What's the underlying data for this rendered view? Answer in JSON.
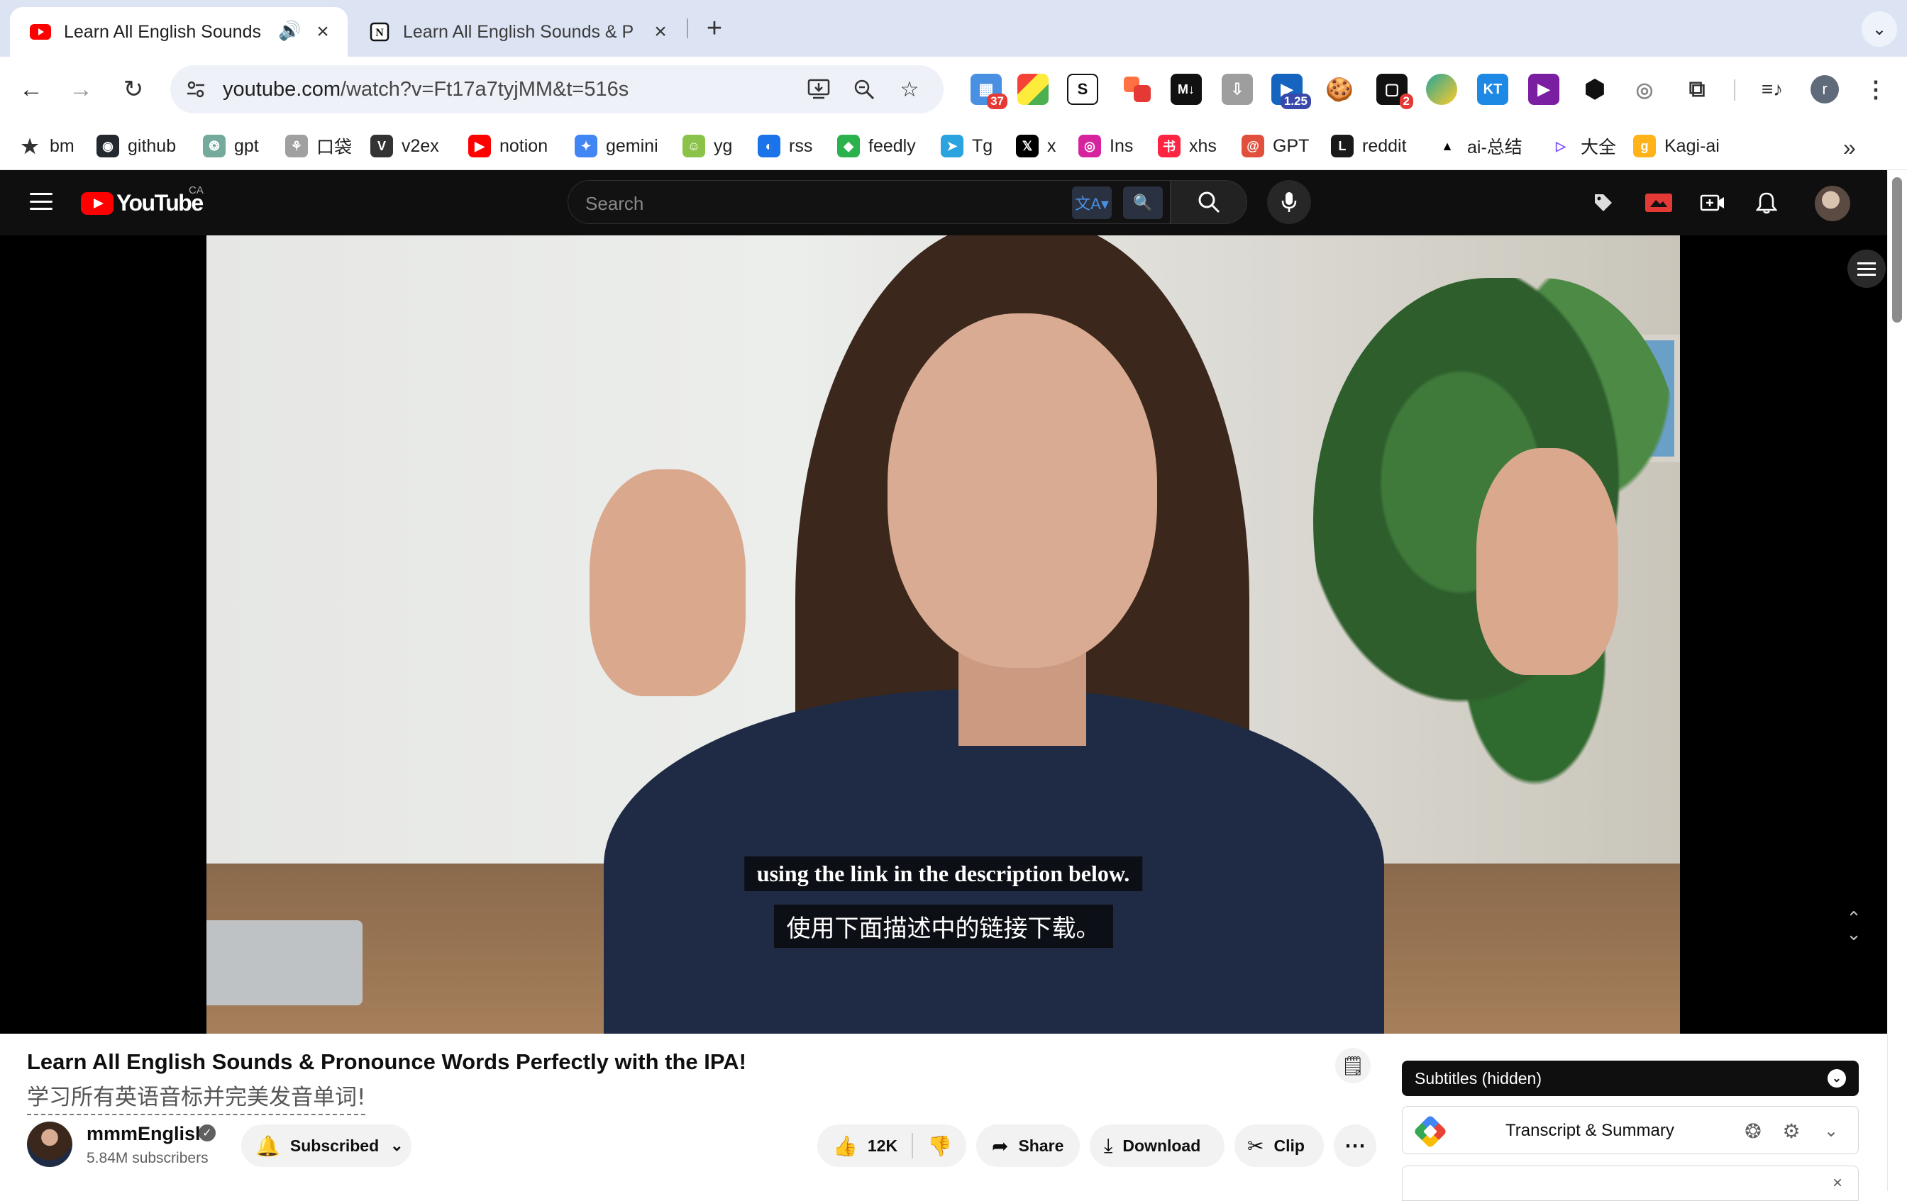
{
  "browser": {
    "tabs": [
      {
        "title": "Learn All English Sounds",
        "favicon": "youtube-icon",
        "audio": "speaker-icon",
        "active": true
      },
      {
        "title": "Learn All English Sounds & P",
        "favicon": "notion-icon",
        "active": false
      }
    ],
    "new_tab": "+",
    "tab_search": "⌄",
    "url_host": "youtube.com",
    "url_path": "/watch?v=Ft17a7tyjMM&t=516s",
    "extensions": [
      {
        "name": "ext-grid",
        "badge": "37"
      },
      {
        "name": "ext-colors"
      },
      {
        "name": "ext-s",
        "label": "S"
      },
      {
        "name": "ext-shapes"
      },
      {
        "name": "ext-markdown",
        "label": "M↓"
      },
      {
        "name": "ext-download"
      },
      {
        "name": "ext-speed",
        "badge": "1.25"
      },
      {
        "name": "ext-cookie"
      },
      {
        "name": "ext-chat",
        "badge": "2"
      },
      {
        "name": "ext-shield"
      },
      {
        "name": "ext-kt",
        "label": "KT"
      },
      {
        "name": "ext-play"
      },
      {
        "name": "ext-cube"
      },
      {
        "name": "ext-eye"
      },
      {
        "name": "ext-puzzle"
      }
    ],
    "profile_initial": "r",
    "bookmarks": [
      {
        "label": "bm",
        "icon": "star-icon",
        "color": "#333333"
      },
      {
        "label": "github",
        "icon": "github-icon",
        "color": "#24292f"
      },
      {
        "label": "gpt",
        "icon": "openai-icon",
        "color": "#74aa9c"
      },
      {
        "label": "口袋",
        "icon": "pocket-icon",
        "color": "#a0a0a0"
      },
      {
        "label": "v2ex",
        "icon": "v2ex-icon",
        "color": "#333333"
      },
      {
        "label": "notion",
        "icon": "youtube-icon",
        "color": "#ff0000"
      },
      {
        "label": "gemini",
        "icon": "gemini-icon",
        "color": "#4285f4"
      },
      {
        "label": "yg",
        "icon": "people-icon",
        "color": "#8bc34a"
      },
      {
        "label": "rss",
        "icon": "rss-icon",
        "color": "#1a73e8"
      },
      {
        "label": "feedly",
        "icon": "feedly-icon",
        "color": "#2bb24c"
      },
      {
        "label": "Tg",
        "icon": "telegram-icon",
        "color": "#2aa3df"
      },
      {
        "label": "x",
        "icon": "x-icon",
        "color": "#000000"
      },
      {
        "label": "Ins",
        "icon": "instagram-icon",
        "color": "#d6249f"
      },
      {
        "label": "xhs",
        "icon": "xiaohongshu-icon",
        "color": "#ff2442"
      },
      {
        "label": "GPT",
        "icon": "spiral-icon",
        "color": "#e0503c"
      },
      {
        "label": "reddit",
        "icon": "reddit-icon",
        "color": "#1a1a1a"
      },
      {
        "label": "ai-总结",
        "icon": "triangle-icon",
        "color": "#000000"
      },
      {
        "label": "大全",
        "icon": "play-outline-icon",
        "color": "#7c4dff"
      },
      {
        "label": "Kagi-ai",
        "icon": "kagi-icon",
        "color": "#ffb319"
      }
    ]
  },
  "youtube": {
    "logo_text": "YouTube",
    "country": "CA",
    "search_placeholder": "Search",
    "player": {
      "caption_en": "using the link in the description below.",
      "caption_zh": "使用下面描述中的链接下载。"
    },
    "video": {
      "title": "Learn All English Sounds & Pronounce Words Perfectly with the IPA!",
      "title_zh": "学习所有英语音标并完美发音单词!",
      "channel": "mmmEnglish",
      "subscribers": "5.84M subscribers",
      "subscribe_label": "Subscribed",
      "likes": "12K",
      "share": "Share",
      "download": "Download",
      "clip": "Clip"
    },
    "side_panel": {
      "subtitles_label": "Subtitles (hidden)",
      "transcript_label": "Transcript & Summary"
    }
  }
}
